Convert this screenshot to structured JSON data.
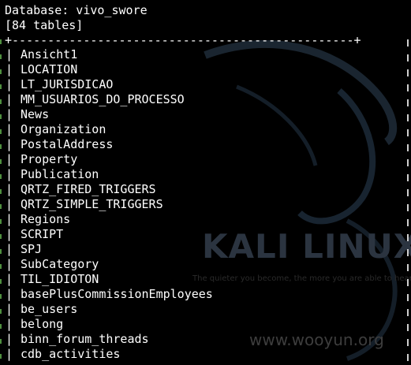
{
  "terminal": {
    "database_line": "Database: vivo_swore",
    "table_count_line": "[84 tables]",
    "border_line": "+------------------------------------------------+"
  },
  "tables": [
    "Ansicht1",
    "LOCATION",
    "LT_JURISDICAO",
    "MM_USUARIOS_DO_PROCESSO",
    "News",
    "Organization",
    "PostalAddress",
    "Property",
    "Publication",
    "QRTZ_FIRED_TRIGGERS",
    "QRTZ_SIMPLE_TRIGGERS",
    "Regions",
    "SCRIPT",
    "SPJ",
    "SubCategory",
    "TIL_IDIOTON",
    "basePlusCommissionEmployees",
    "be_users",
    "belong",
    "binn_forum_threads",
    "cdb_activities"
  ],
  "wallpaper": {
    "brand": "KALI LINUX",
    "tagline": "The quieter you become, the more you are able to hear",
    "watermark": "www.wooyun.org",
    "dragon_icon": "kali-dragon-icon"
  },
  "colors": {
    "background": "#000000",
    "text": "#ffffff",
    "brand": "#2b3440"
  }
}
